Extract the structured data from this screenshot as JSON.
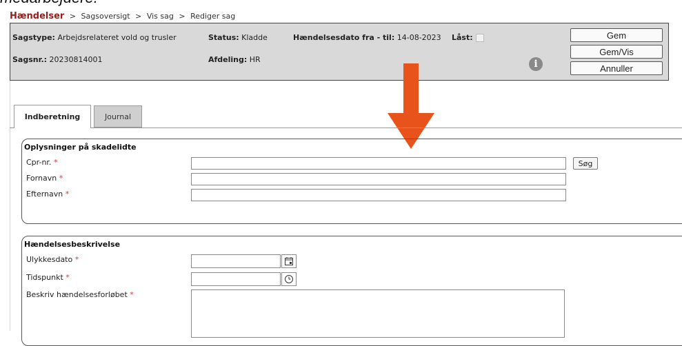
{
  "document": {
    "top_text": "medarbejdere."
  },
  "breadcrumb": {
    "root": "Hændelser",
    "separator": ">",
    "items": [
      "Sagsoversigt",
      "Vis sag",
      "Rediger sag"
    ]
  },
  "case": {
    "type_label": "Sagstype:",
    "type_value": "Arbejdsrelateret vold og trusler",
    "number_label": "Sagsnr.:",
    "number_value": "20230814001",
    "status_label": "Status:",
    "status_value": "Kladde",
    "department_label": "Afdeling:",
    "department_value": "HR",
    "date_range_label": "Hændelsesdato fra - til:",
    "date_range_value": "14-08-2023",
    "locked_label": "Låst:",
    "locked": false
  },
  "actions": {
    "save": "Gem",
    "save_view": "Gem/Vis",
    "cancel": "Annuller"
  },
  "tabs": [
    {
      "label": "Indberetning",
      "active": true
    },
    {
      "label": "Journal",
      "active": false
    }
  ],
  "injured_section": {
    "title": "Oplysninger på skadelidte",
    "cpr_label": "Cpr-nr.",
    "first_name_label": "Fornavn",
    "last_name_label": "Efternavn",
    "search_button": "Søg",
    "required_marker": "*"
  },
  "event_section": {
    "title": "Hændelsesbeskrivelse",
    "accident_date_label": "Ulykkesdato",
    "time_label": "Tidspunkt",
    "description_label": "Beskriv hændelsesforløbet",
    "required_marker": "*"
  },
  "icons": {
    "info": "info-icon",
    "calendar": "calendar-icon",
    "clock": "clock-icon",
    "annotation_arrow": "arrow-down-icon"
  },
  "colors": {
    "breadcrumb_root": "#9b1c1c",
    "required": "#d23b3b",
    "arrow": "#e8531c",
    "header_bg": "#d9d9d9"
  }
}
